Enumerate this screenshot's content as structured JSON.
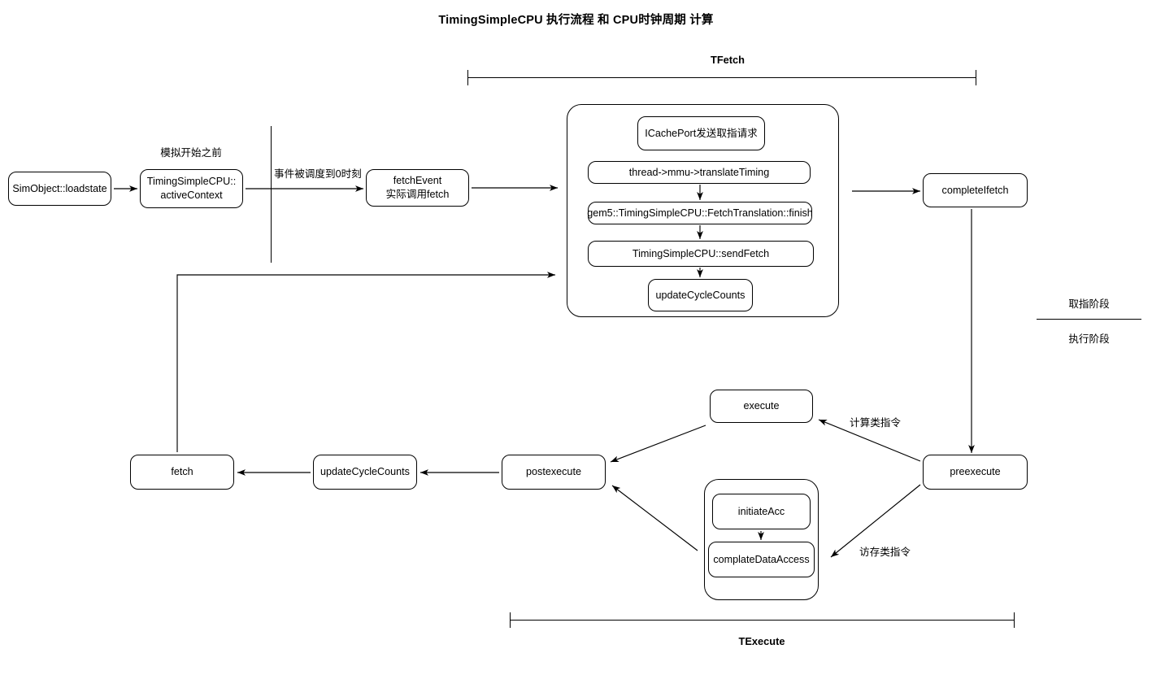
{
  "title": "TimingSimpleCPU 执行流程 和 CPU时钟周期 计算",
  "brackets": {
    "fetch": {
      "label": "TFetch"
    },
    "execute": {
      "label": "TExecute"
    }
  },
  "stage_divider": {
    "top_label": "取指阶段",
    "bottom_label": "执行阶段"
  },
  "edge_labels": {
    "before_sim": "模拟开始之前",
    "event_scheduled": "事件被调度到0时刻",
    "compute_instr": "计算类指令",
    "memory_instr": "访存类指令"
  },
  "nodes": {
    "loadstate": "SimObject::loadstate",
    "active_context": "TimingSimpleCPU::\nactiveContext",
    "fetch_event": "fetchEvent\n实际调用fetch",
    "icache_port": "ICachePort发送取指请求",
    "translate_timing": "thread->mmu->translateTiming",
    "fetch_translation_finish": "gem5::TimingSimpleCPU::FetchTranslation::finish",
    "send_fetch": "TimingSimpleCPU::sendFetch",
    "update_cycle_counts_fetch": "updateCycleCounts",
    "complete_ifetch": "completeIfetch",
    "preexecute": "preexecute",
    "execute": "execute",
    "initiate_acc": "initiateAcc",
    "complate_data_access": "complateDataAccess",
    "postexecute": "postexecute",
    "update_cycle_counts_exec": "updateCycleCounts",
    "fetch": "fetch"
  },
  "colors": {
    "stroke": "#000000",
    "background": "#ffffff",
    "text": "#000000"
  }
}
